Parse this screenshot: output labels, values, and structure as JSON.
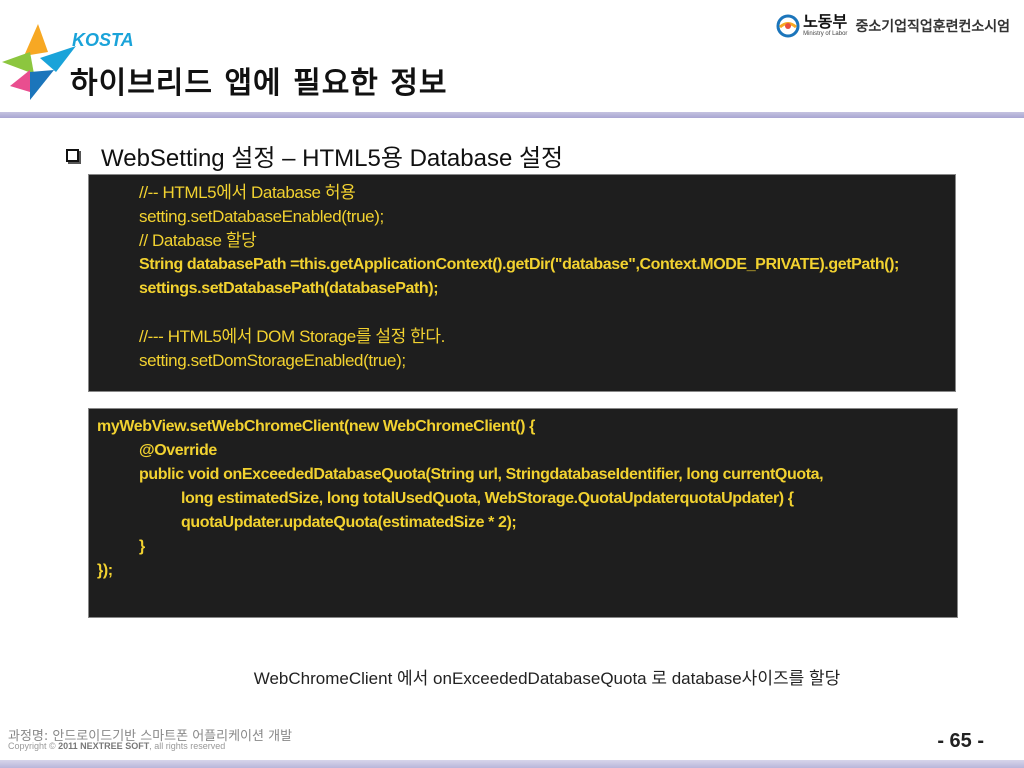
{
  "header": {
    "logo_text": "KOSTA",
    "title": "하이브리드 앱에 필요한 정보",
    "ministry_name": "노동부",
    "ministry_english": "Ministry of Labor",
    "organization": "중소기업직업훈련컨소시엄"
  },
  "bullet": {
    "text": "WebSetting 설정 – HTML5용 Database 설정"
  },
  "code_block_1": {
    "lines": [
      "//-- HTML5에서 Database 허용",
      "setting.setDatabaseEnabled(true);",
      "// Database 할당",
      "String databasePath =this.getApplicationContext().getDir(\"database\",Context.MODE_PRIVATE).getPath();",
      "settings.setDatabasePath(databasePath);",
      "",
      "//--- HTML5에서 DOM Storage를 설정 한다.",
      "setting.setDomStorageEnabled(true);"
    ]
  },
  "code_block_2": {
    "lines": [
      "myWebView.setWebChromeClient(new WebChromeClient() {",
      "@Override",
      "public void onExceededDatabaseQuota(String url, StringdatabaseIdentifier, long currentQuota,",
      "long estimatedSize, long totalUsedQuota, WebStorage.QuotaUpdaterquotaUpdater) {",
      "quotaUpdater.updateQuota(estimatedSize * 2);",
      "}",
      "});"
    ]
  },
  "caption": "WebChromeClient 에서 onExceededDatabaseQuota 로 database사이즈를 할당",
  "footer": {
    "course": "과정명: 안드로이드기반 스마트폰 어플리케이션 개발",
    "copyright_prefix": "Copyright © ",
    "copyright_company": "2011 NEXTREE SOFT",
    "copyright_suffix": ", all rights reserved",
    "page_number": "- 65 -"
  },
  "colors": {
    "code_background": "#1e1e1e",
    "code_text": "#f2d230",
    "header_bar": "#a9a6d2",
    "logo_blue": "#1aa3d9"
  }
}
